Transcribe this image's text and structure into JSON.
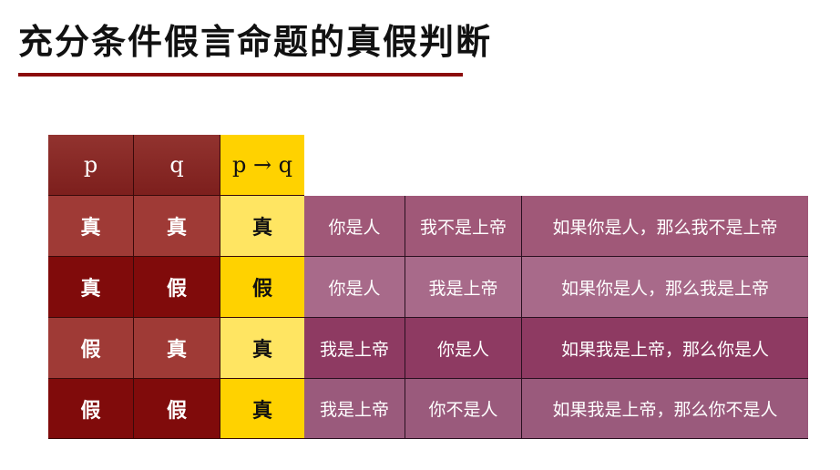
{
  "title": "充分条件假言命题的真假判断",
  "colors": {
    "title_underline": "#8b0c0c",
    "header_red": "#8a2a27",
    "true_false_dark": "#800b0b",
    "true_false_light": "#9f3a36",
    "implication_yellow": "#ffd200",
    "example_purple": "#a05878"
  },
  "table": {
    "headers": [
      "p",
      "q",
      "p → q"
    ],
    "rows": [
      {
        "p": "真",
        "q": "真",
        "pq": "真",
        "ex_p": "你是人",
        "ex_q": "我不是上帝",
        "ex_stmt": "如果你是人，那么我不是上帝"
      },
      {
        "p": "真",
        "q": "假",
        "pq": "假",
        "ex_p": "你是人",
        "ex_q": "我是上帝",
        "ex_stmt": "如果你是人，那么我是上帝"
      },
      {
        "p": "假",
        "q": "真",
        "pq": "真",
        "ex_p": "我是上帝",
        "ex_q": "你是人",
        "ex_stmt": "如果我是上帝，那么你是人"
      },
      {
        "p": "假",
        "q": "假",
        "pq": "真",
        "ex_p": "我是上帝",
        "ex_q": "你不是人",
        "ex_stmt": "如果我是上帝，那么你不是人"
      }
    ]
  }
}
